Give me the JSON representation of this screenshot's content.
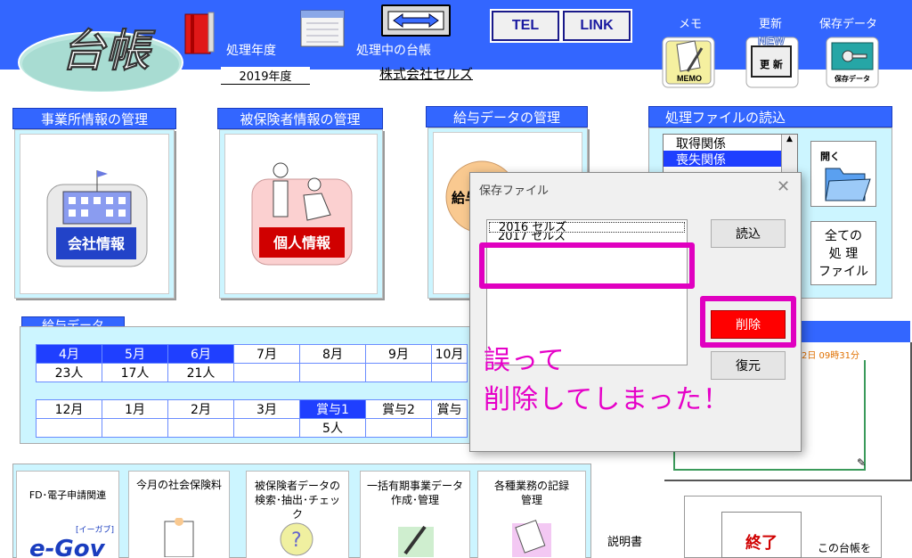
{
  "header": {
    "logo_text": "台帳",
    "fiscal_year_label": "処理年度",
    "fiscal_year_value": "2019年度",
    "current_ledger_label": "処理中の台帳",
    "current_ledger_value": "株式会社セルズ",
    "tel_label": "TEL",
    "link_label": "LINK",
    "memo_label": "メモ",
    "memo_icon_text": "MEMO",
    "update_label": "更新",
    "update_icon_text": "更 新",
    "update_new_text": "NEW",
    "saved_data_label": "保存データ",
    "saved_data_icon_text": "保存データ"
  },
  "sections": {
    "office": {
      "title": "事業所情報の管理",
      "button": "会社情報"
    },
    "insured": {
      "title": "被保険者情報の管理",
      "button": "個人情報"
    },
    "salary": {
      "title": "給与データの管理",
      "button": "給与"
    },
    "file_load": {
      "title": "処理ファイルの読込",
      "items": [
        "取得関係",
        "喪失関係"
      ],
      "open_label": "開く",
      "all_files_label": [
        "全ての",
        "処 理",
        "ファイル"
      ]
    }
  },
  "salary_data": {
    "title": "給与データ",
    "row1_months": [
      "4月",
      "5月",
      "6月",
      "7月",
      "8月",
      "9月",
      "10月"
    ],
    "row1_counts": [
      "23人",
      "17人",
      "21人",
      "",
      "",
      "",
      ""
    ],
    "row2_months": [
      "12月",
      "1月",
      "2月",
      "3月",
      "賞与1",
      "賞与2",
      "賞与"
    ],
    "row2_counts": [
      "",
      "",
      "",
      "",
      "5人",
      "",
      ""
    ]
  },
  "memo_panel": {
    "timestamp": "2日 09時31分"
  },
  "bottom": {
    "fd_label": "FD･電子申請関連",
    "egov_label": "e-Gov",
    "egov_sub": "[イーガブ]",
    "monthly_label": "今月の社会保険料",
    "search_label": "被保険者データの検索･抽出･チェック",
    "bulk_label": "一括有期事業データ作成･管理",
    "records_label": "各種業務の記録管理",
    "manual_label": "説明書",
    "exit_label": "終了",
    "ledger_note": "この台帳を"
  },
  "dialog": {
    "title": "保存ファイル",
    "close_glyph": "✕",
    "list_items": [
      "2016 セルズ",
      "2017 セルズ"
    ],
    "load_button": "読込",
    "delete_button": "削除",
    "restore_button": "復元"
  },
  "annotation": {
    "line1": "誤って",
    "line2": "削除してしまった！",
    "color": "#e600c8"
  }
}
